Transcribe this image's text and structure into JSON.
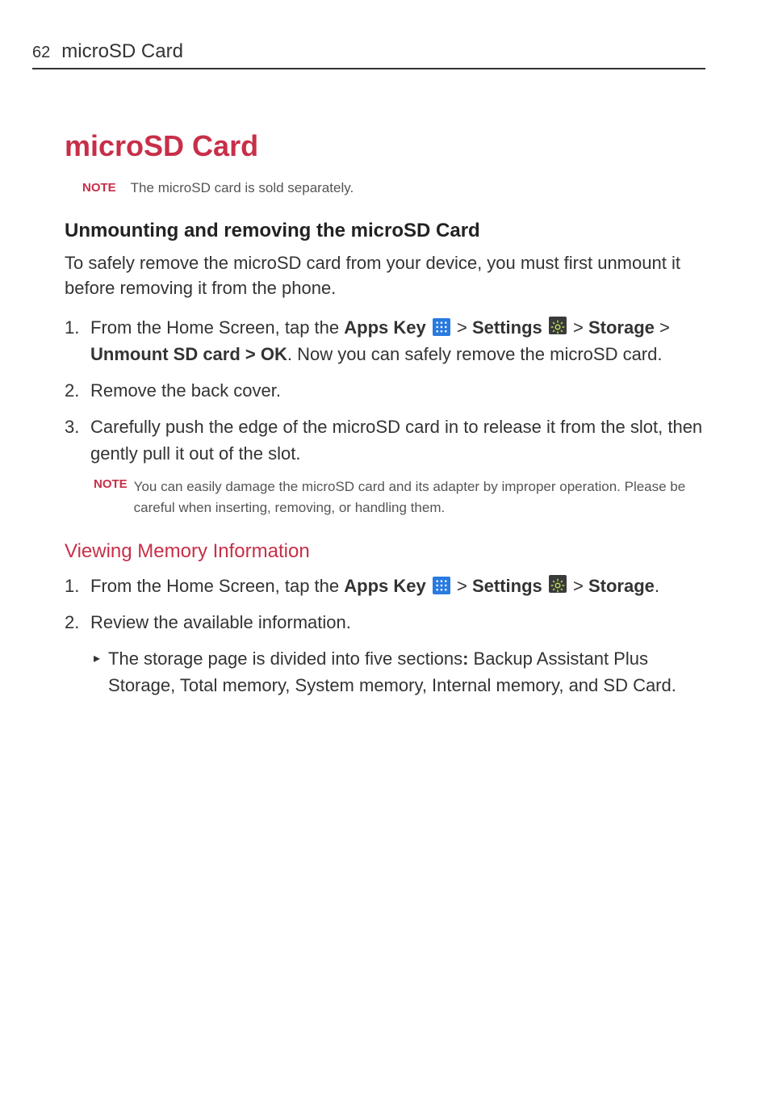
{
  "header": {
    "page_number": "62",
    "title": "microSD Card"
  },
  "title": "microSD Card",
  "note1": {
    "label": "NOTE",
    "text": "The microSD card is sold separately."
  },
  "section1": {
    "heading": "Unmounting and removing the microSD Card",
    "intro": "To safely remove the microSD card from your device, you must first unmount it before removing it from the phone.",
    "steps": {
      "s1_num": "1.",
      "s1_pre": "From the Home Screen, tap the ",
      "apps_key": "Apps Key",
      "gt1": " > ",
      "settings": "Settings",
      "gt2": " > ",
      "storage": "Storage",
      "gt3": " > ",
      "unmount": "Unmount SD card >  OK",
      "s1_post": ". Now you can safely remove the microSD card.",
      "s2_num": "2.",
      "s2_text": "Remove the back cover.",
      "s3_num": "3.",
      "s3_text": "Carefully push the edge of the microSD card in to release it from the slot, then gently pull it out of the slot."
    },
    "note2": {
      "label": "NOTE",
      "text": "You can easily damage the microSD card and its adapter by improper operation. Please be careful when inserting, removing, or handling them."
    }
  },
  "section2": {
    "heading": "Viewing Memory Information",
    "steps": {
      "s1_num": "1.",
      "s1_pre": "From the Home Screen, tap the ",
      "apps_key": "Apps Key",
      "gt1": " > ",
      "settings": "Settings",
      "gt2": " > ",
      "storage": "Storage",
      "s1_post": ".",
      "s2_num": "2.",
      "s2_text": "Review the available information."
    },
    "bullet": {
      "marker": "▸",
      "pre": "The storage page is divided into five sections",
      "colon_bold": ":",
      "post": " Backup Assistant Plus Storage, Total memory, System memory, Internal memory, and SD Card."
    }
  }
}
